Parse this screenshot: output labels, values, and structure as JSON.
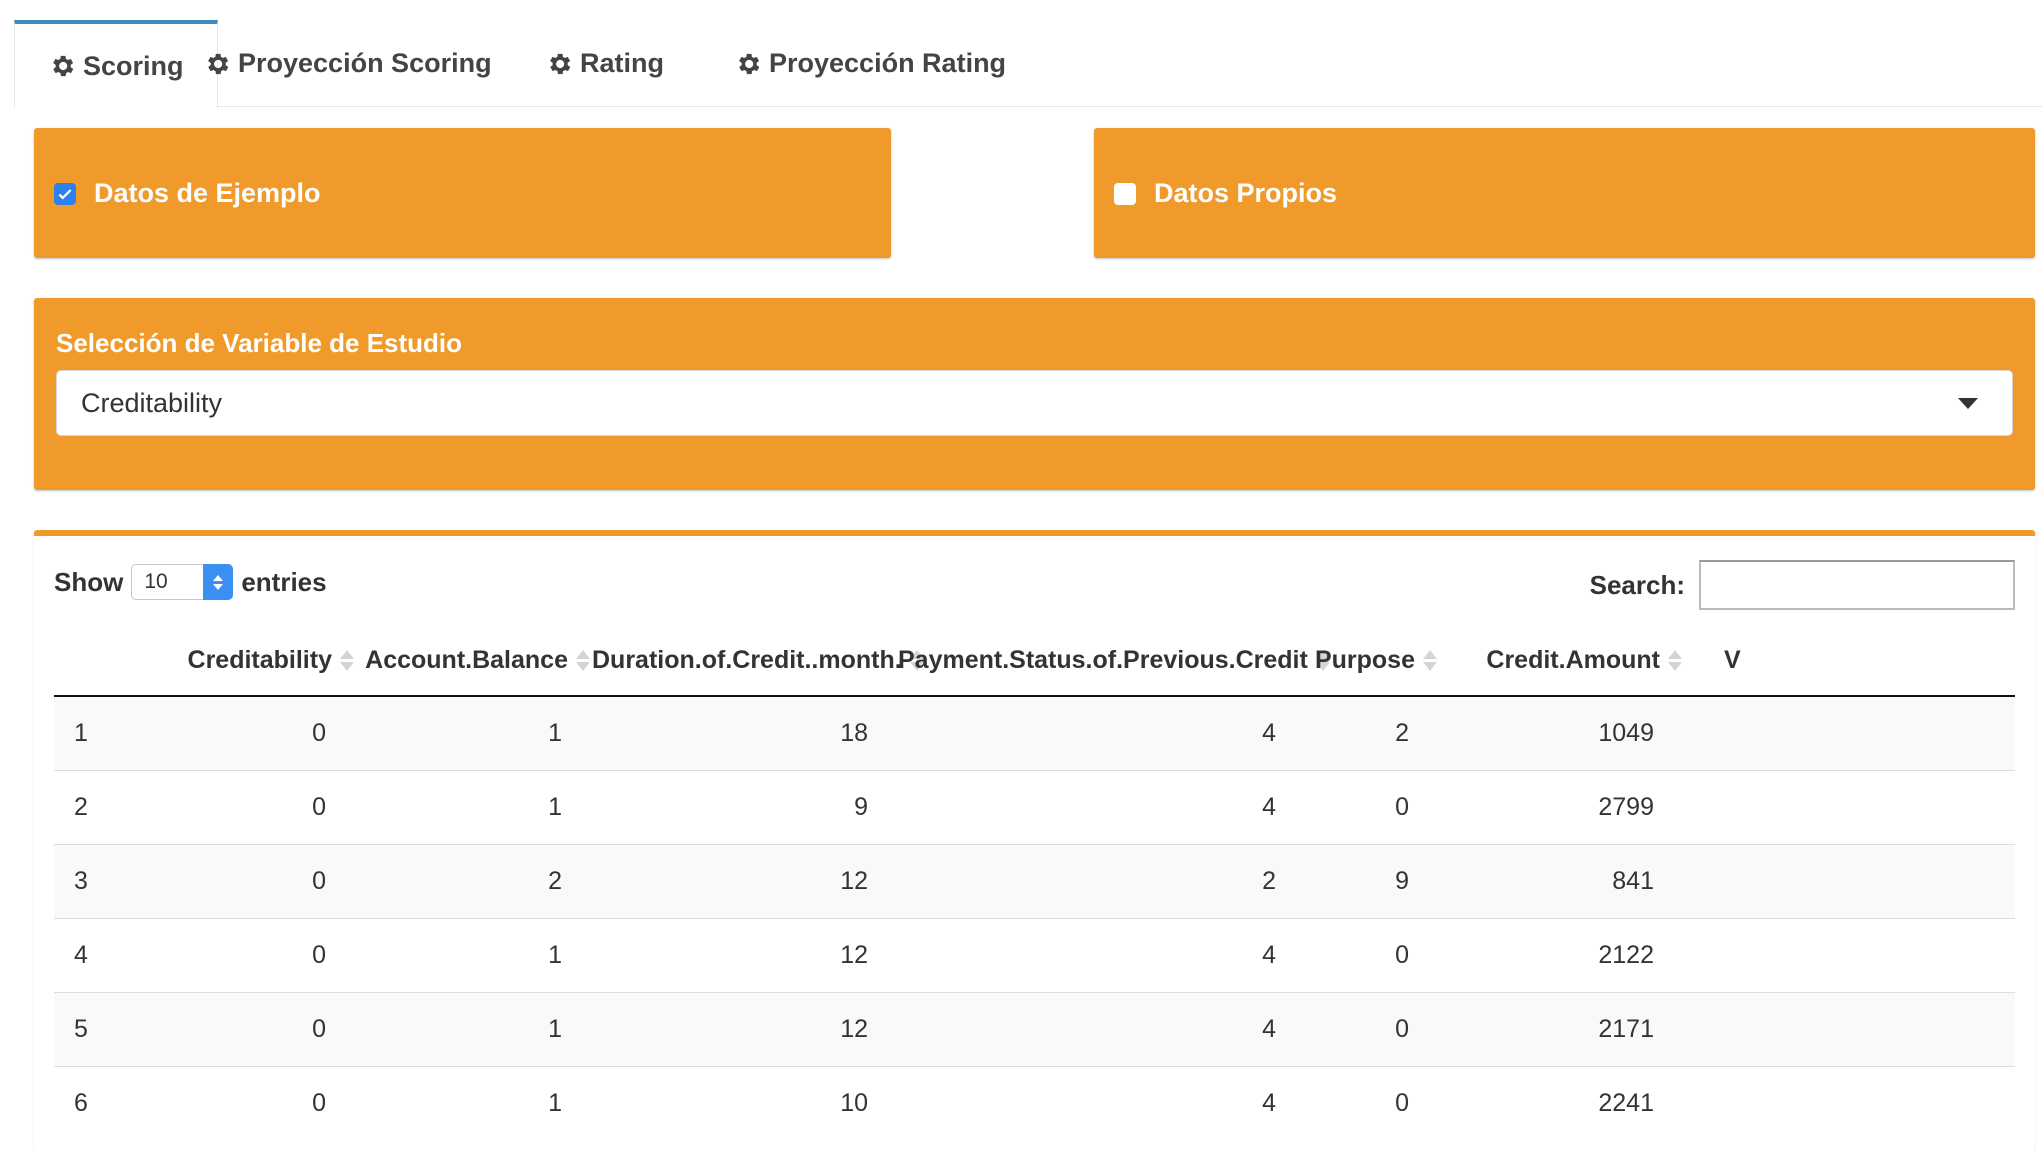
{
  "tabs": [
    {
      "label": "Scoring",
      "icon": "gear-icon",
      "active": true
    },
    {
      "label": "Proyección Scoring",
      "icon": "gear-icon",
      "active": false
    },
    {
      "label": "Rating",
      "icon": "gear-icon",
      "active": false
    },
    {
      "label": "Proyección Rating",
      "icon": "gear-icon",
      "active": false
    }
  ],
  "colors": {
    "accent": "#f09a2b",
    "tab_active_border": "#3c8dbc",
    "checkbox_checked": "#2f80ed"
  },
  "data_source": {
    "example": {
      "label": "Datos de Ejemplo",
      "checked": true
    },
    "own": {
      "label": "Datos Propios",
      "checked": false
    }
  },
  "variable_select": {
    "label": "Selección de Variable de Estudio",
    "value": "Creditability"
  },
  "table_controls": {
    "show_label": "Show",
    "length_value": "10",
    "entries_label": "entries",
    "search_label": "Search:",
    "search_value": ""
  },
  "table": {
    "columns": [
      "",
      "Creditability",
      "Account.Balance",
      "Duration.of.Credit..month.",
      "Payment.Status.of.Previous.Credit",
      "Purpose",
      "Credit.Amount",
      "V"
    ],
    "rows": [
      [
        "1",
        "0",
        "1",
        "18",
        "4",
        "2",
        "1049"
      ],
      [
        "2",
        "0",
        "1",
        "9",
        "4",
        "0",
        "2799"
      ],
      [
        "3",
        "0",
        "2",
        "12",
        "2",
        "9",
        "841"
      ],
      [
        "4",
        "0",
        "1",
        "12",
        "4",
        "0",
        "2122"
      ],
      [
        "5",
        "0",
        "1",
        "12",
        "4",
        "0",
        "2171"
      ],
      [
        "6",
        "0",
        "1",
        "10",
        "4",
        "0",
        "2241"
      ]
    ]
  }
}
